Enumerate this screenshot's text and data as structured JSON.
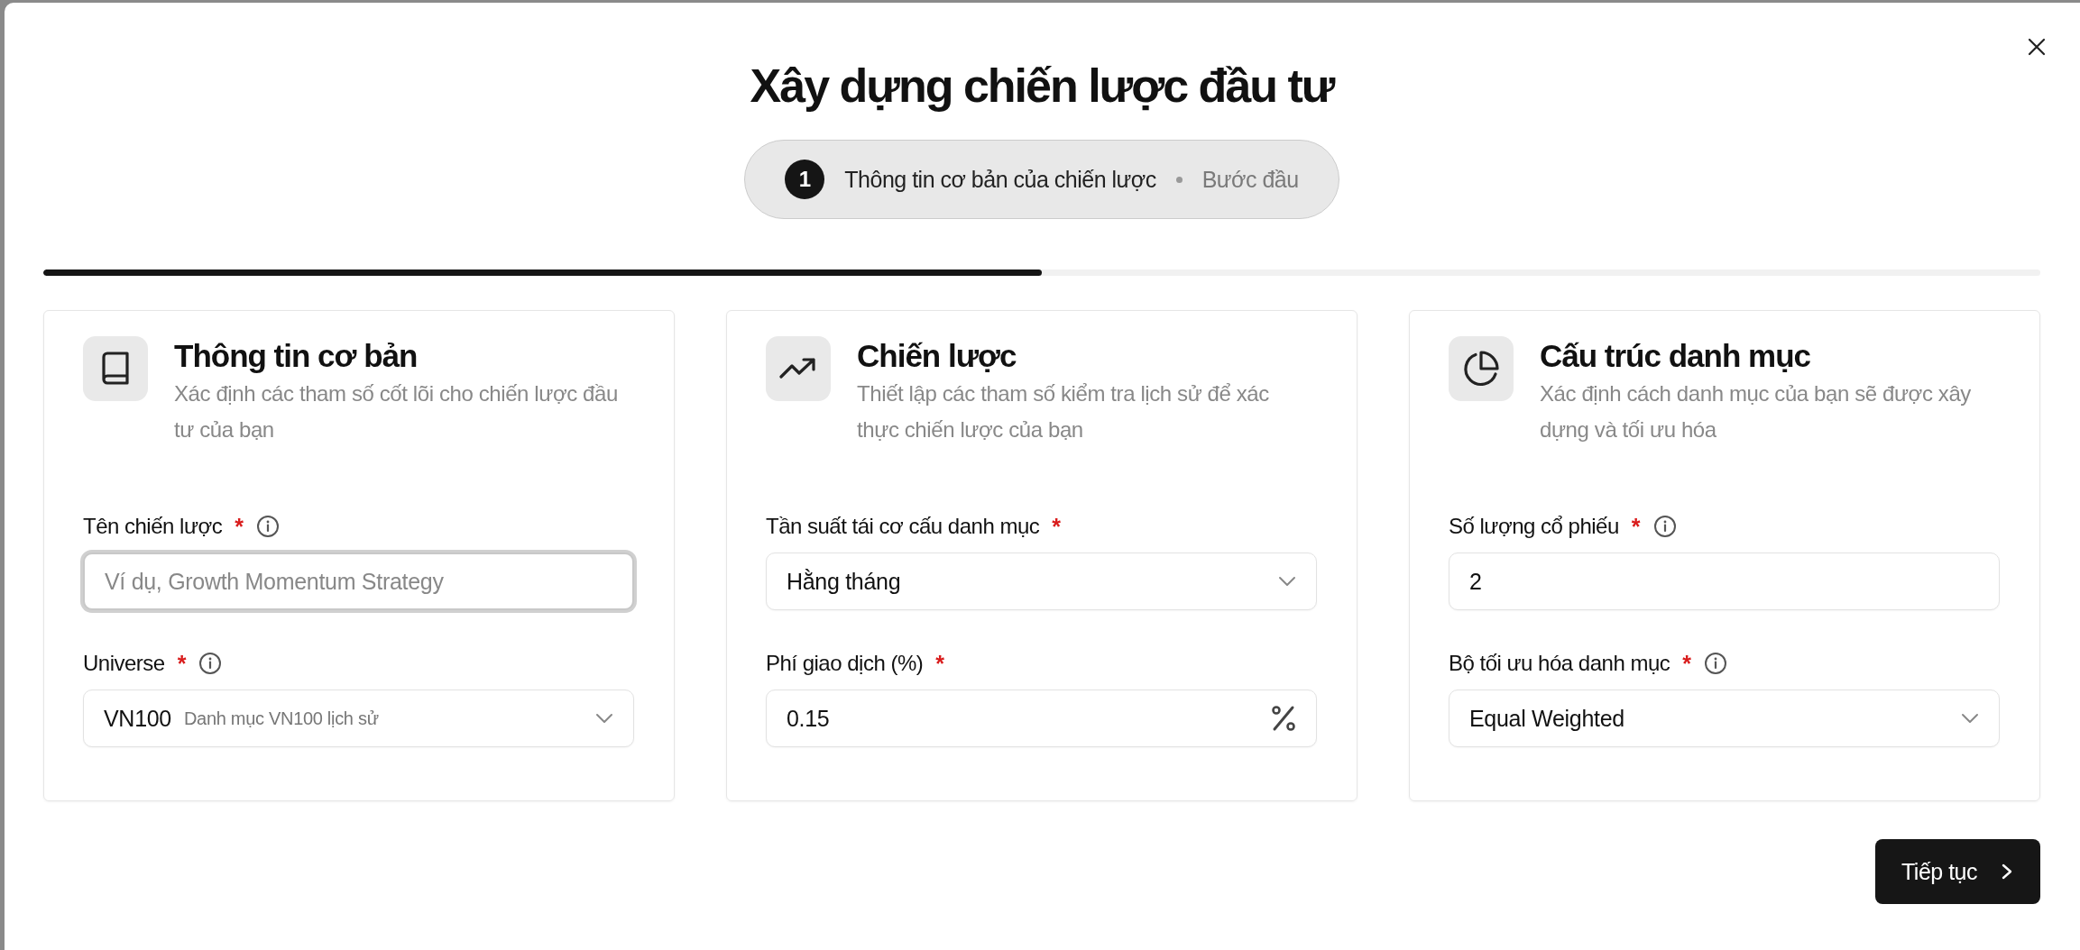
{
  "dialog": {
    "title": "Xây dựng chiến lược đầu tư"
  },
  "step": {
    "number": "1",
    "name": "Thông tin cơ bản của chiến lược",
    "stage": "Bước đầu"
  },
  "progress": {
    "level": 0.5
  },
  "cards": [
    {
      "title": "Thông tin cơ bản",
      "description": "Xác định các tham số cốt lõi cho chiến lược đầu tư của bạn",
      "fields": [
        {
          "label": "Tên chiến lược",
          "required_mark": "*",
          "info": true,
          "kind": "text",
          "placeholder": "Ví dụ, Growth Momentum Strategy",
          "focused": true
        },
        {
          "label": "Universe",
          "required_mark": "*",
          "info": true,
          "kind": "select",
          "value": "VN100",
          "note": "Danh mục VN100 lịch sử"
        }
      ]
    },
    {
      "title": "Chiến lược",
      "description": "Thiết lập các tham số kiểm tra lịch sử để xác thực chiến lược của bạn",
      "fields": [
        {
          "label": "Tần suất tái cơ cấu danh mục",
          "required_mark": "*",
          "info": false,
          "kind": "select",
          "value": "Hằng tháng"
        },
        {
          "label": "Phí giao dịch (%)",
          "required_mark": "*",
          "info": false,
          "kind": "percent",
          "value": "0.15"
        }
      ]
    },
    {
      "title": "Cấu trúc danh mục",
      "description": "Xác định cách danh mục của bạn sẽ được xây dựng và tối ưu hóa",
      "fields": [
        {
          "label": "Số lượng cổ phiếu",
          "required_mark": "*",
          "info": true,
          "kind": "text",
          "value": "2",
          "focused": false
        },
        {
          "label": "Bộ tối ưu hóa danh mục",
          "required_mark": "*",
          "info": true,
          "kind": "select",
          "value": "Equal Weighted"
        }
      ]
    }
  ],
  "continue_button": {
    "label": "Tiếp tục"
  }
}
